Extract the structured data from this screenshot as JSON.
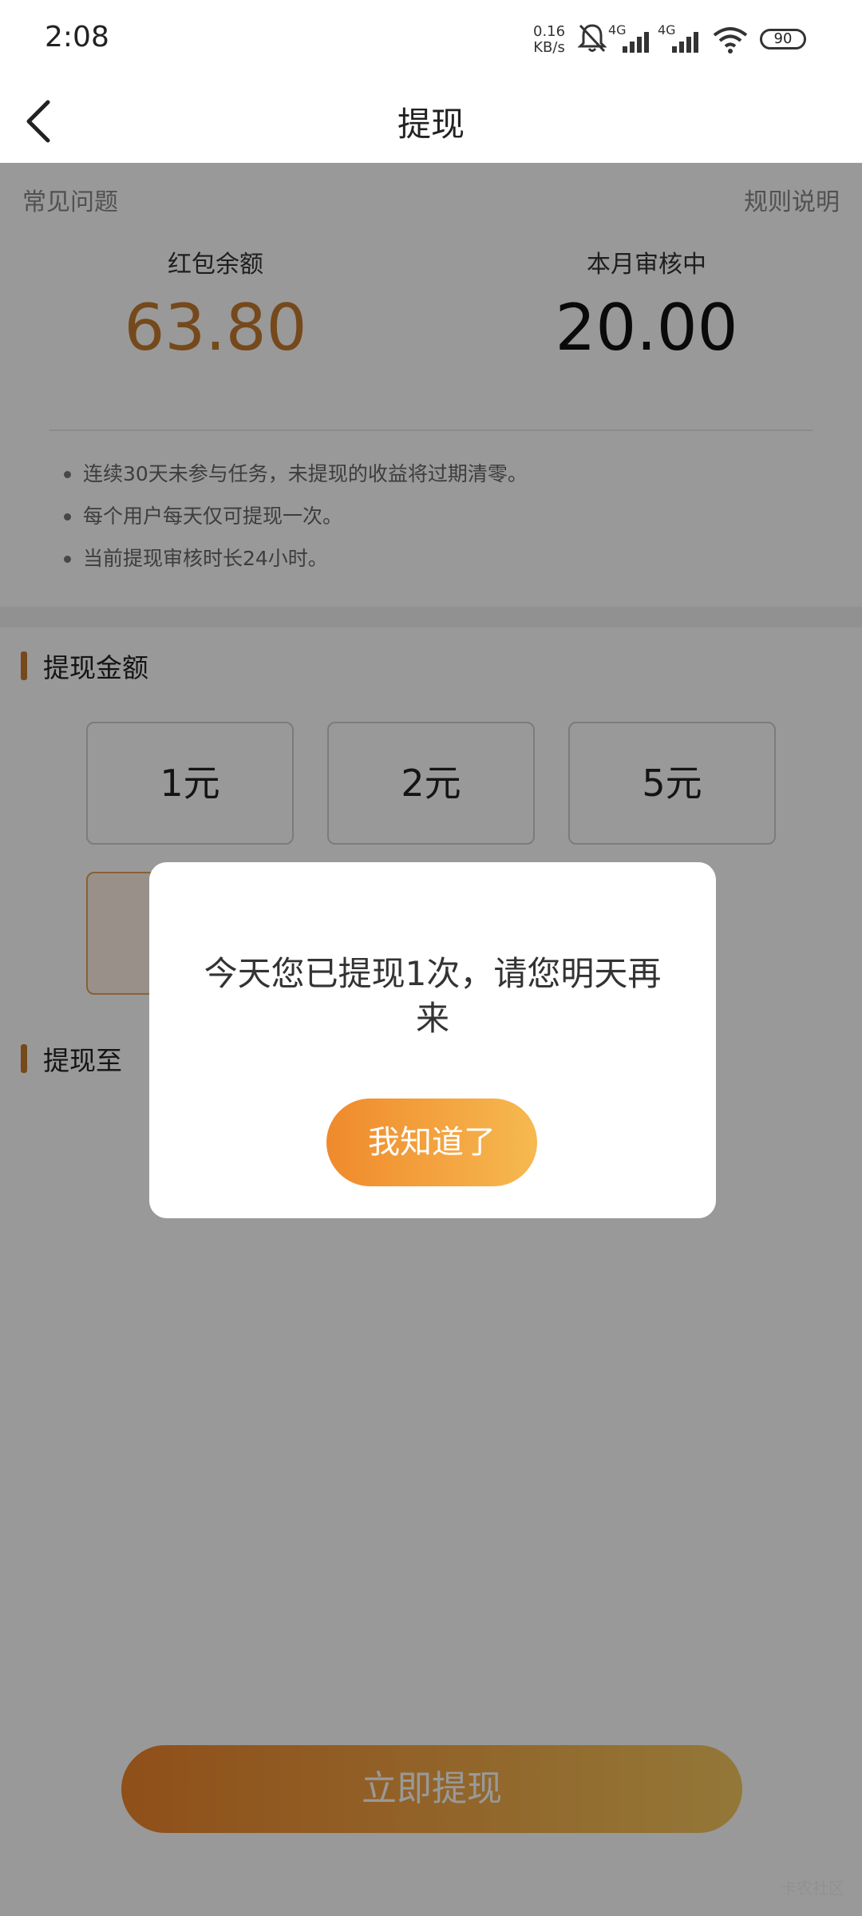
{
  "status_bar": {
    "time": "2:08",
    "net_speed_value": "0.16",
    "net_speed_unit": "KB/s",
    "sim1": "4G",
    "sim2": "4G",
    "battery": "90"
  },
  "header": {
    "title": "提现"
  },
  "links": {
    "faq": "常见问题",
    "rules": "规则说明"
  },
  "balance": {
    "label": "红包余额",
    "value": "63.80",
    "color": "#c47a2e"
  },
  "pending": {
    "label": "本月审核中",
    "value": "20.00"
  },
  "notes": [
    "连续30天未参与任务，未提现的收益将过期清零。",
    "每个用户每天仅可提现一次。",
    "当前提现审核时长24小时。"
  ],
  "withdraw_amount": {
    "title": "提现金额",
    "options": [
      "1元",
      "2元",
      "5元"
    ]
  },
  "withdraw_to": {
    "title": "提现至"
  },
  "submit": {
    "label": "立即提现"
  },
  "dialog": {
    "message": "今天您已提现1次，请您明天再来",
    "confirm_label": "我知道了"
  },
  "watermark": "卡农社区",
  "colors": {
    "accent": "#c47a2e",
    "button_gradient_start": "#f0842b",
    "button_gradient_end": "#f6c85f"
  }
}
